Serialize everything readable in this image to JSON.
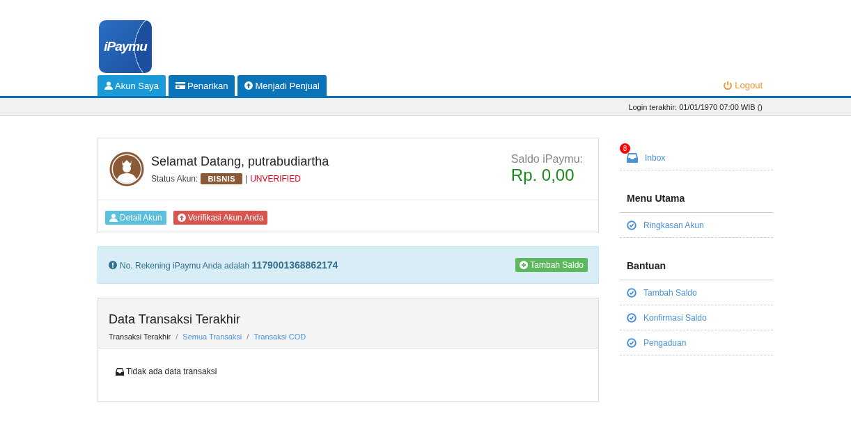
{
  "logo": {
    "text": "iPaymu"
  },
  "nav": {
    "tabs": [
      {
        "label": "Akun Saya",
        "kind": "user",
        "selected": true
      },
      {
        "label": "Penarikan",
        "kind": "card",
        "selected": false
      },
      {
        "label": "Menjadi Penjual",
        "kind": "up",
        "selected": false
      }
    ],
    "logout": "Logout"
  },
  "status_bar": {
    "last_login": "Login terakhir: 01/01/1970 07:00 WIB ()"
  },
  "account_card": {
    "greeting": "Selamat Datang, putrabudiartha",
    "status_label": "Status Akun:",
    "badge": "BISNIS",
    "separator": "|",
    "verification": "UNVERIFIED",
    "balance_label": "Saldo iPaymu:",
    "balance": "Rp. 0,00",
    "buttons": [
      {
        "label": "Detail Akun",
        "kind": "info"
      },
      {
        "label": "Verifikasi Akun Anda",
        "kind": "danger"
      }
    ]
  },
  "account_notice": {
    "text": "No. Rekening iPaymu Anda adalah",
    "number": "1179001368862174",
    "button": "Tambah Saldo"
  },
  "transactions": {
    "title": "Data Transaksi Terakhir",
    "breadcrumb": [
      {
        "label": "Transaksi Terakhir",
        "selected": true
      },
      {
        "label": "Semua Transaksi",
        "selected": false
      },
      {
        "label": "Transaksi COD",
        "selected": false
      }
    ],
    "breadcrumb_separator": "/",
    "empty": "Tidak ada data transaksi"
  },
  "sidebar": {
    "inbox": {
      "label": "Inbox",
      "badge": "8"
    },
    "sections": [
      {
        "title": "Menu Utama",
        "items": [
          "Ringkasan Akun"
        ]
      },
      {
        "title": "Bantuan",
        "items": [
          "Tambah Saldo",
          "Konfirmasi Saldo",
          "Pengaduan"
        ]
      }
    ]
  }
}
